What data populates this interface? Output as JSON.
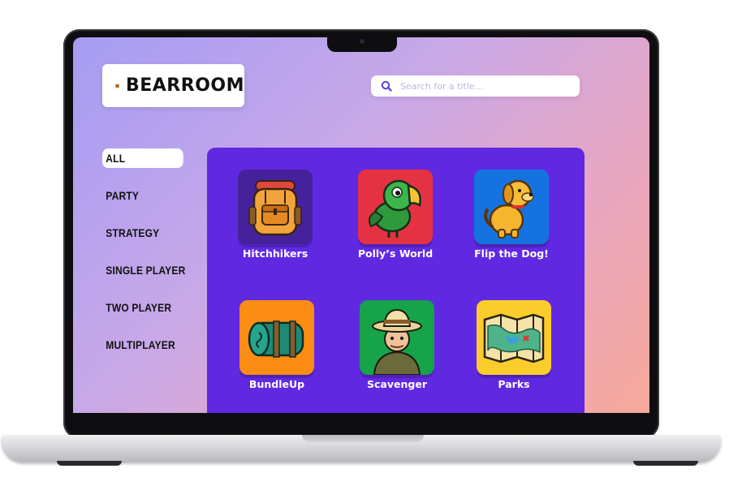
{
  "brand": {
    "name": "BEARROOM",
    "logo_icon": "bear-icon"
  },
  "search": {
    "placeholder": "Search for a title...",
    "value": "",
    "icon": "search-icon"
  },
  "categories": [
    {
      "label": "ALL",
      "active": true
    },
    {
      "label": "PARTY",
      "active": false
    },
    {
      "label": "STRATEGY",
      "active": false
    },
    {
      "label": "SINGLE PLAYER",
      "active": false
    },
    {
      "label": "TWO PLAYER",
      "active": false
    },
    {
      "label": "MULTIPLAYER",
      "active": false
    }
  ],
  "games": [
    {
      "title": "Hitchhikers",
      "icon": "backpack-icon",
      "color": "#45229b"
    },
    {
      "title": "Polly’s World",
      "icon": "parrot-icon",
      "color": "#e53242"
    },
    {
      "title": "Flip the Dog!",
      "icon": "dog-icon",
      "color": "#1473e0"
    },
    {
      "title": "BundleUp",
      "icon": "sleeping-bag-icon",
      "color": "#fb8c14"
    },
    {
      "title": "Scavenger",
      "icon": "explorer-icon",
      "color": "#16a34a"
    },
    {
      "title": "Parks",
      "icon": "map-icon",
      "color": "#facc2c"
    }
  ],
  "colors": {
    "panel": "#6029e1",
    "accent": "#5b3fd6",
    "gradient_start": "#a59cf3",
    "gradient_end": "#f7a99a"
  }
}
